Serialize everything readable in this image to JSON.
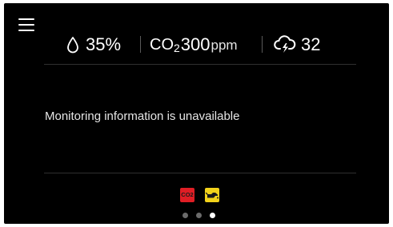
{
  "stats": {
    "humidity": {
      "icon": "water-drop-icon",
      "value": "35%"
    },
    "co2": {
      "label": "CO",
      "subscript": "2",
      "value": "300",
      "unit": "ppm"
    },
    "weather": {
      "icon": "thunderstorm-cloud-icon",
      "value": "32"
    }
  },
  "message": "Monitoring information is unavailable",
  "alerts": [
    {
      "icon": "co2-alert-icon",
      "label": "CO2",
      "color": "#e01e25"
    },
    {
      "icon": "oil-can-icon",
      "color": "#f2d21b"
    }
  ],
  "pagination": {
    "pages": 3,
    "active_index": 2
  },
  "colors": {
    "background": "#000000",
    "text": "#ffffff",
    "divider": "#2f2f2f"
  }
}
